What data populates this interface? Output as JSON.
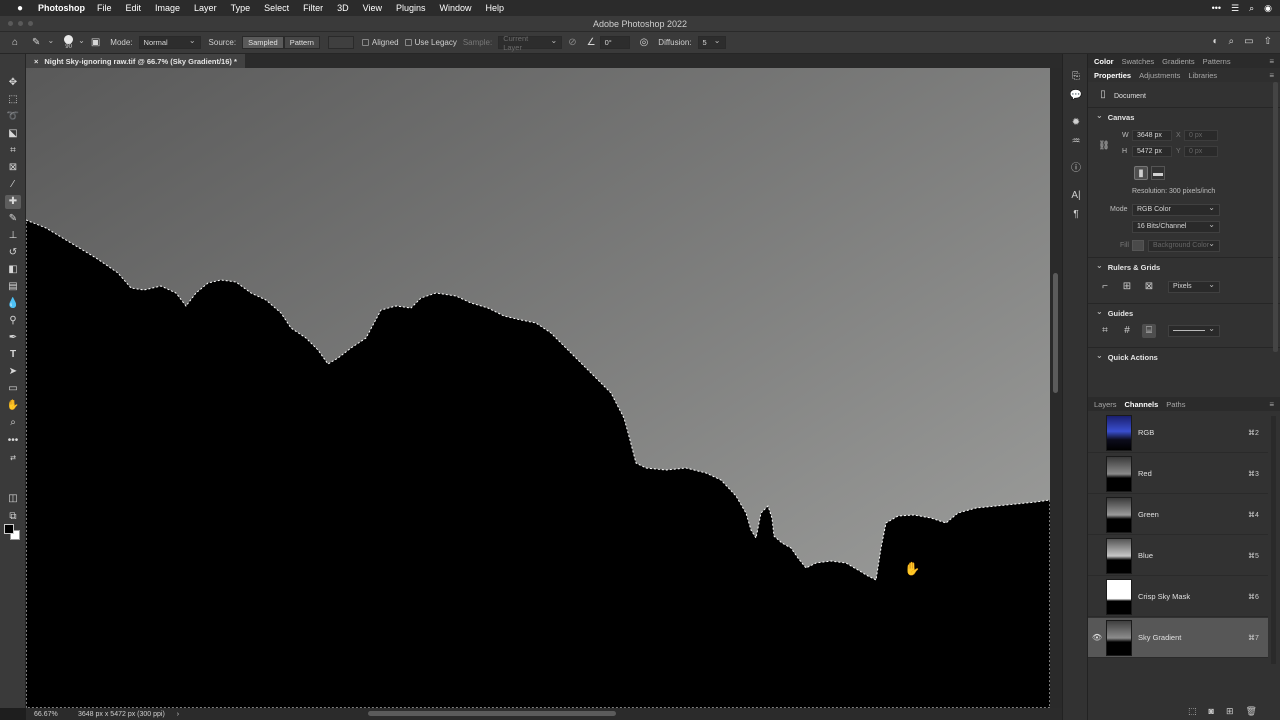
{
  "menubar": {
    "apple": "",
    "app": "Photoshop",
    "items": [
      "File",
      "Edit",
      "Image",
      "Layer",
      "Type",
      "Select",
      "Filter",
      "3D",
      "View",
      "Plugins",
      "Window",
      "Help"
    ]
  },
  "window": {
    "title": "Adobe Photoshop 2022"
  },
  "options": {
    "brush_size": "90",
    "mode_label": "Mode:",
    "mode_value": "Normal",
    "source_label": "Source:",
    "source_sampled": "Sampled",
    "source_pattern": "Pattern",
    "aligned": "Aligned",
    "use_legacy": "Use Legacy",
    "sample_label": "Sample:",
    "sample_value": "Current Layer",
    "angle_value": "0°",
    "diffusion_label": "Diffusion:",
    "diffusion_value": "5"
  },
  "document": {
    "tab_title": "Night Sky-ignoring raw.tif @ 66.7% (Sky Gradient/16) *",
    "close": "×"
  },
  "status": {
    "zoom": "66.67%",
    "info": "3648 px x 5472 px (300 ppi)",
    "arrow": "›"
  },
  "panels": {
    "top_tabs": [
      "Color",
      "Swatches",
      "Gradients",
      "Patterns"
    ],
    "prop_tabs": [
      "Properties",
      "Adjustments",
      "Libraries"
    ],
    "document_label": "Document",
    "canvas": {
      "title": "Canvas",
      "w_label": "W",
      "w_value": "3648 px",
      "h_label": "H",
      "h_value": "5472 px",
      "x_label": "X",
      "x_value": "0 px",
      "y_label": "Y",
      "y_value": "0 px",
      "resolution": "Resolution: 300 pixels/inch",
      "mode_label": "Mode",
      "mode_value": "RGB Color",
      "bits_value": "16 Bits/Channel",
      "fill_label": "Fill",
      "fill_value": "Background Color"
    },
    "rulers": {
      "title": "Rulers & Grids",
      "units": "Pixels"
    },
    "guides": {
      "title": "Guides"
    },
    "quick_actions": {
      "title": "Quick Actions"
    },
    "layer_tabs": [
      "Layers",
      "Channels",
      "Paths"
    ],
    "channels": [
      {
        "name": "RGB",
        "key": "⌘2"
      },
      {
        "name": "Red",
        "key": "⌘3"
      },
      {
        "name": "Green",
        "key": "⌘4"
      },
      {
        "name": "Blue",
        "key": "⌘5"
      },
      {
        "name": "Crisp Sky Mask",
        "key": "⌘6"
      },
      {
        "name": "Sky Gradient",
        "key": "⌘7"
      }
    ]
  },
  "colors": {
    "sky_top": "#5c5c5c",
    "sky_bottom": "#9a9b99",
    "selected_row": "#575757"
  }
}
